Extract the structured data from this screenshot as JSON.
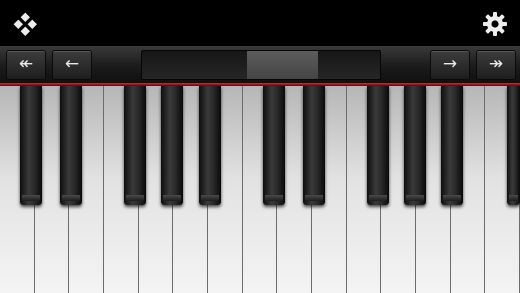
{
  "toolbar": {
    "menu_icon": "menu-icon",
    "settings_icon": "gear-icon"
  },
  "navigation": {
    "ff_left_label": "↞",
    "left_label": "←",
    "right_label": "→",
    "ff_right_label": "↠",
    "scroll_position_fraction": 0.44,
    "visible_range_fraction": 0.3
  },
  "keyboard": {
    "white_key_count": 15,
    "black_key_count": 10,
    "accent_color": "#c8302e"
  }
}
